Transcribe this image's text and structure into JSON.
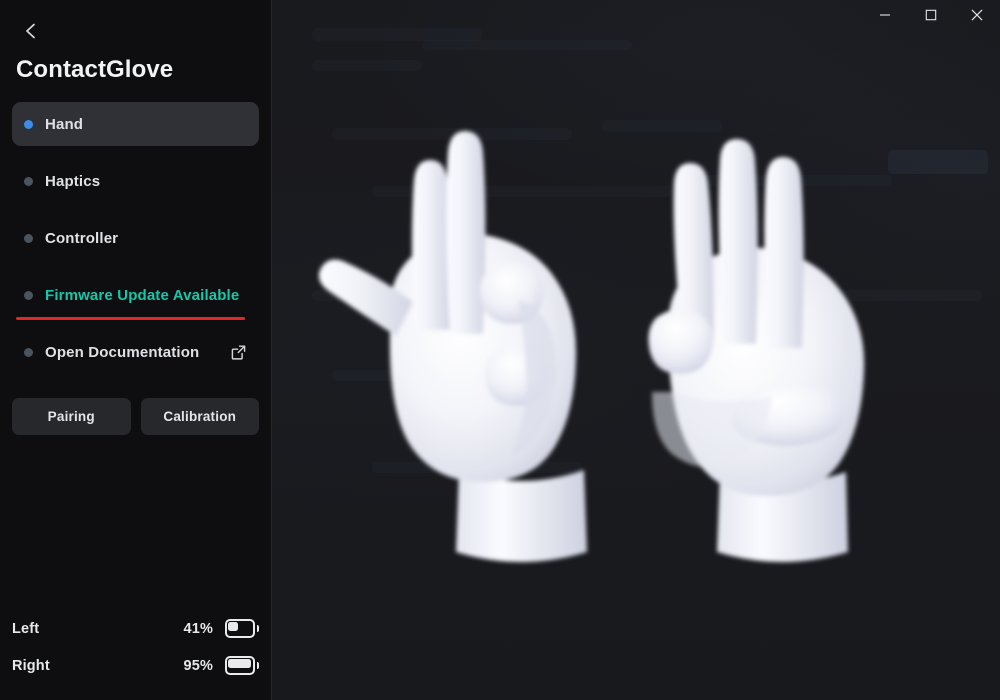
{
  "window": {
    "title": "ContactGlove",
    "controls": [
      {
        "name": "minimize",
        "glyph": "minimize-icon",
        "label": "Minimize"
      },
      {
        "name": "maximize",
        "glyph": "maximize-icon",
        "label": "Maximize"
      },
      {
        "name": "close",
        "glyph": "close-icon",
        "label": "Close"
      }
    ]
  },
  "sidebar": {
    "back_label": "Back",
    "title": "ContactGlove",
    "items": [
      {
        "label": "Hand",
        "active": true,
        "dot": "#3b8dea",
        "accent": "#dfe1e5",
        "external": false,
        "underline": false
      },
      {
        "label": "Haptics",
        "active": false,
        "dot": "#49545f",
        "accent": "#dfe1e5",
        "external": false,
        "underline": false
      },
      {
        "label": "Controller",
        "active": false,
        "dot": "#49545f",
        "accent": "#dfe1e5",
        "external": false,
        "underline": false
      },
      {
        "label": "Firmware Update Available",
        "active": false,
        "dot": "#49545f",
        "accent": "#16c8a8",
        "external": false,
        "underline": true
      },
      {
        "label": "Open Documentation",
        "active": false,
        "dot": "#49545f",
        "accent": "#dfe1e5",
        "external": true,
        "underline": false
      }
    ],
    "buttons": [
      {
        "label": "Pairing"
      },
      {
        "label": "Calibration"
      }
    ],
    "batteries": [
      {
        "name": "Left",
        "percent_label": "41%",
        "percent": 41
      },
      {
        "name": "Right",
        "percent_label": "95%",
        "percent": 95
      }
    ]
  },
  "main": {
    "view": "hand-preview",
    "hands": [
      {
        "side": "left",
        "pose": "two-fingers-extended-thumb-out"
      },
      {
        "side": "right",
        "pose": "three-fingers-extended"
      }
    ]
  },
  "colors": {
    "sidebar_bg": "#0e0e11",
    "content_bg": "#1a1b1f",
    "active_item_bg": "#303137",
    "accent_blue": "#3b8dea",
    "accent_teal": "#16c8a8",
    "alert_red": "#e02828",
    "text_primary": "#dfe1e5",
    "glove_white": "#eceef5"
  }
}
